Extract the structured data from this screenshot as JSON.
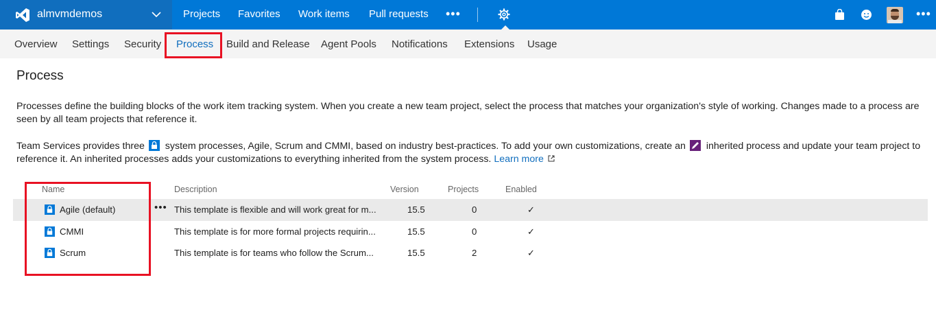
{
  "topbar": {
    "account_name": "almvmdemos",
    "nav": [
      "Projects",
      "Favorites",
      "Work items",
      "Pull requests"
    ],
    "more_label": "•••",
    "right_more_label": "•••",
    "icons": [
      "visual-studio-logo-icon",
      "chevron-down-icon",
      "gear-icon",
      "shopping-bag-icon",
      "smiley-icon",
      "avatar"
    ],
    "colors": {
      "bar": "#0078d7",
      "brand_area": "#106ebe"
    }
  },
  "subnav": {
    "items": [
      "Overview",
      "Settings",
      "Security",
      "Process",
      "Build and Release",
      "Agent Pools",
      "Notifications",
      "Extensions",
      "Usage"
    ],
    "active": "Process",
    "colors": {
      "active": "#106ebe",
      "highlight": "#e81123"
    }
  },
  "page": {
    "title": "Process",
    "para1": "Processes define the building blocks of the work item tracking system. When you create a new team project, select the process that matches your organization's style of working. Changes made to a process are seen by all team projects that reference it.",
    "para2_a": "Team Services provides three",
    "para2_b": "system processes, Agile, Scrum and CMMI, based on industry best-practices. To add your own customizations, create an",
    "para2_c": "inherited process and update your team project to reference it. An inherited processes adds your customizations to everything inherited from the system process.",
    "learn_more": "Learn more"
  },
  "table": {
    "headers": {
      "name": "Name",
      "description": "Description",
      "version": "Version",
      "projects": "Projects",
      "enabled": "Enabled"
    },
    "row_more_label": "•••",
    "rows": [
      {
        "name": "Agile (default)",
        "description": "This template is flexible and will work great for m...",
        "version": "15.5",
        "projects": "0",
        "enabled": "✓",
        "selected": true
      },
      {
        "name": "CMMI",
        "description": "This template is for more formal projects requirin...",
        "version": "15.5",
        "projects": "0",
        "enabled": "✓",
        "selected": false
      },
      {
        "name": "Scrum",
        "description": "This template is for teams who follow the Scrum...",
        "version": "15.5",
        "projects": "2",
        "enabled": "✓",
        "selected": false
      }
    ]
  }
}
